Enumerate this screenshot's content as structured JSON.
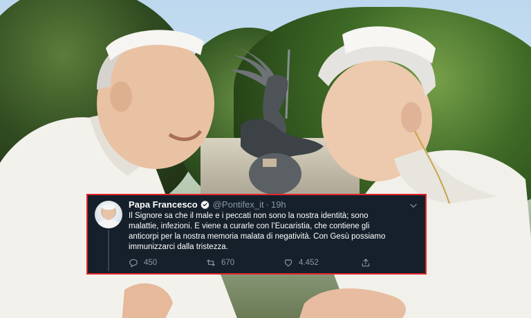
{
  "tweet": {
    "display_name": "Papa Francesco",
    "handle": "@Pontifex_it",
    "separator": "·",
    "time": "19h",
    "text_lines": [
      "Il Signore sa che il male e i peccati non sono la nostra identità; sono",
      "malattie, infezioni. E viene a curarle con l’Eucaristia, che contiene gli",
      "anticorpi per la nostra memoria malata di negatività. Con Gesù possiamo",
      "immunizzarci dalla tristezza."
    ],
    "replies": "450",
    "retweets": "670",
    "likes": "4.452",
    "icons": {
      "verified": "verified-badge-icon",
      "reply": "reply-icon",
      "retweet": "retweet-icon",
      "like": "heart-icon",
      "share": "share-icon",
      "menu": "chevron-down-icon"
    },
    "colors": {
      "background": "#15202b",
      "border": "#e3242b",
      "secondary_text": "#8899a6",
      "verified": "#ffffff"
    }
  }
}
